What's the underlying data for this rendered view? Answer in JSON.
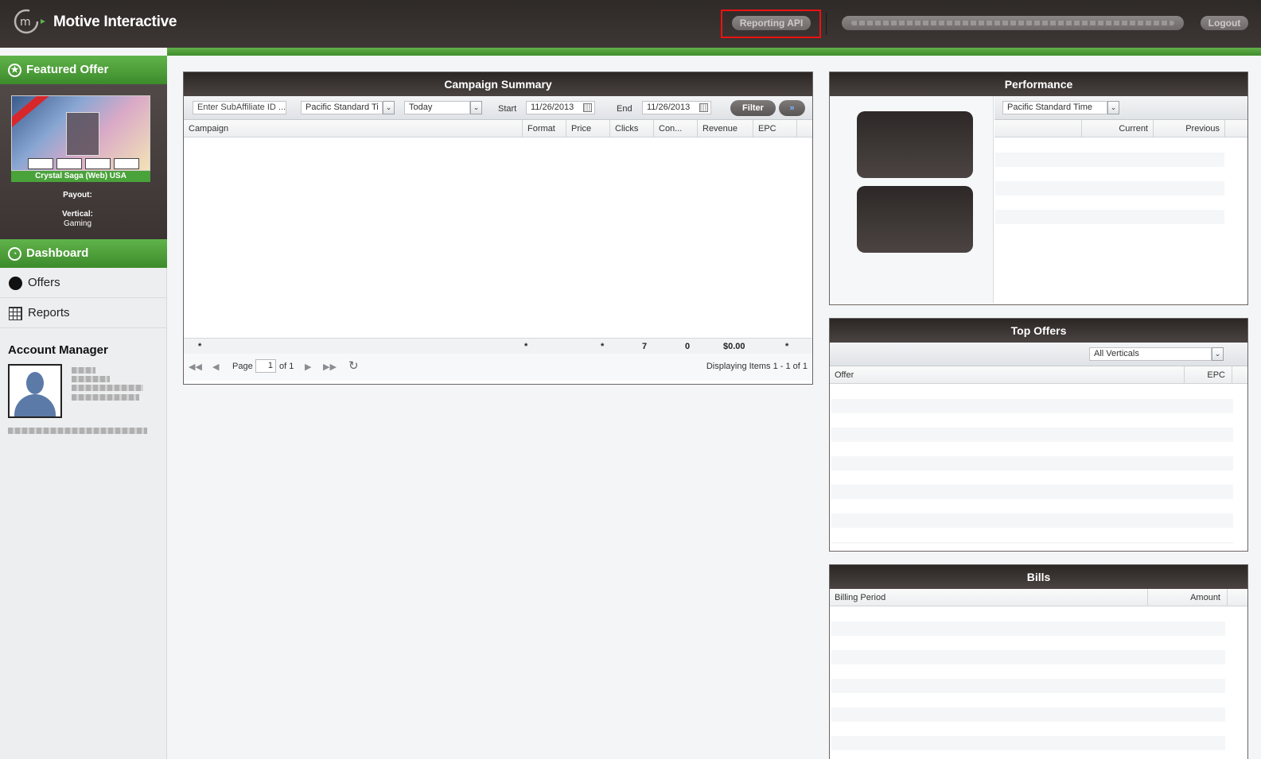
{
  "header": {
    "app_title": "Motive Interactive",
    "reporting_api_label": "Reporting API",
    "user_info": "",
    "logout_label": "Logout"
  },
  "sidebar": {
    "featured_offer": {
      "title": "Featured Offer",
      "offer_name": "Crystal Saga (Web) USA",
      "payout_label": "Payout:",
      "vertical_label": "Vertical:",
      "vertical_value": "Gaming"
    },
    "nav": [
      {
        "label": "Dashboard",
        "icon": "dashboard-icon",
        "active": true
      },
      {
        "label": "Offers",
        "icon": "dot-icon",
        "active": false
      },
      {
        "label": "Reports",
        "icon": "grid-icon",
        "active": false
      }
    ],
    "account_manager_title": "Account Manager"
  },
  "campaign_summary": {
    "title": "Campaign Summary",
    "subaffiliate_placeholder": "Enter SubAffiliate ID ...",
    "timezone": "Pacific Standard Ti",
    "range": "Today",
    "start_label": "Start",
    "start_date": "11/26/2013",
    "end_label": "End",
    "end_date": "11/26/2013",
    "filter_label": "Filter",
    "more_label": "»",
    "columns": [
      "Campaign",
      "Format",
      "Price",
      "Clicks",
      "Con...",
      "Revenue",
      "EPC"
    ],
    "summary": {
      "campaign": "*",
      "format": "*",
      "price": "*",
      "clicks": "7",
      "conversions": "0",
      "revenue": "$0.00",
      "epc": "*"
    },
    "pager": {
      "page_label": "Page",
      "page_value": "1",
      "of_label": "of 1",
      "display": "Displaying Items 1 - 1 of 1"
    }
  },
  "performance": {
    "title": "Performance",
    "timezone": "Pacific Standard Time",
    "columns": [
      "",
      "Current",
      "Previous"
    ]
  },
  "top_offers": {
    "title": "Top Offers",
    "vertical_filter": "All Verticals",
    "columns": [
      "Offer",
      "EPC"
    ]
  },
  "bills": {
    "title": "Bills",
    "columns": [
      "Billing Period",
      "Amount"
    ]
  },
  "colors": {
    "header_bg": "#3a3331",
    "accent_green": "#4ea23a",
    "panel_title_bg": "#2b2625",
    "highlight_red": "#e11111"
  }
}
